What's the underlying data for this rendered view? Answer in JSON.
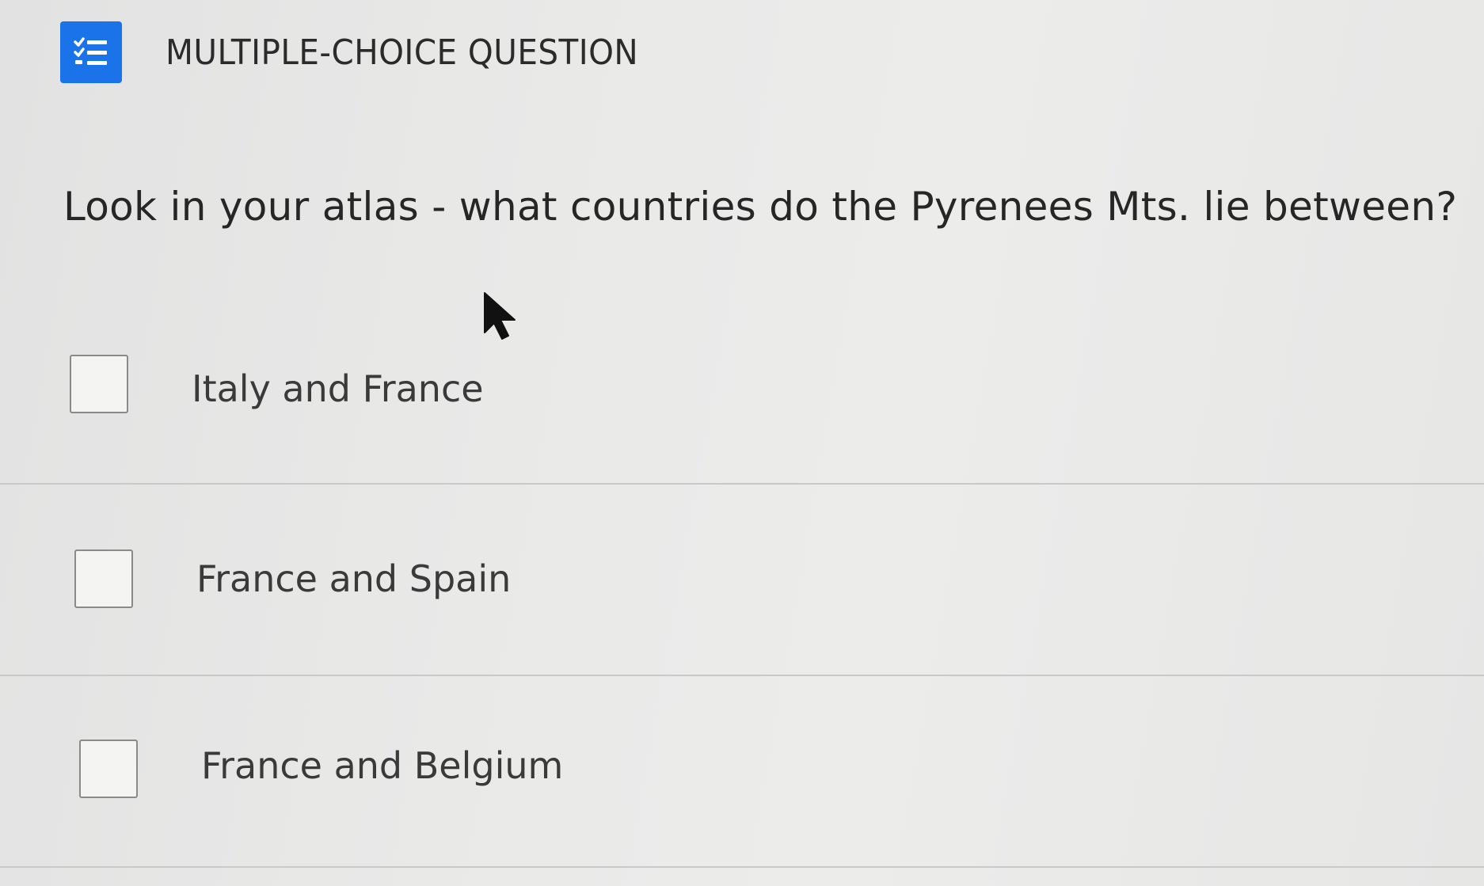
{
  "header": {
    "type_icon": "checklist-icon",
    "type_label": "MULTIPLE-CHOICE QUESTION",
    "accent_color": "#1a73e8"
  },
  "question": {
    "text": "Look in your atlas - what countries do the Pyrenees Mts. lie between?"
  },
  "options": [
    {
      "label": "Italy and France",
      "checked": false
    },
    {
      "label": "France and Spain",
      "checked": false
    },
    {
      "label": "France and Belgium",
      "checked": false
    }
  ]
}
